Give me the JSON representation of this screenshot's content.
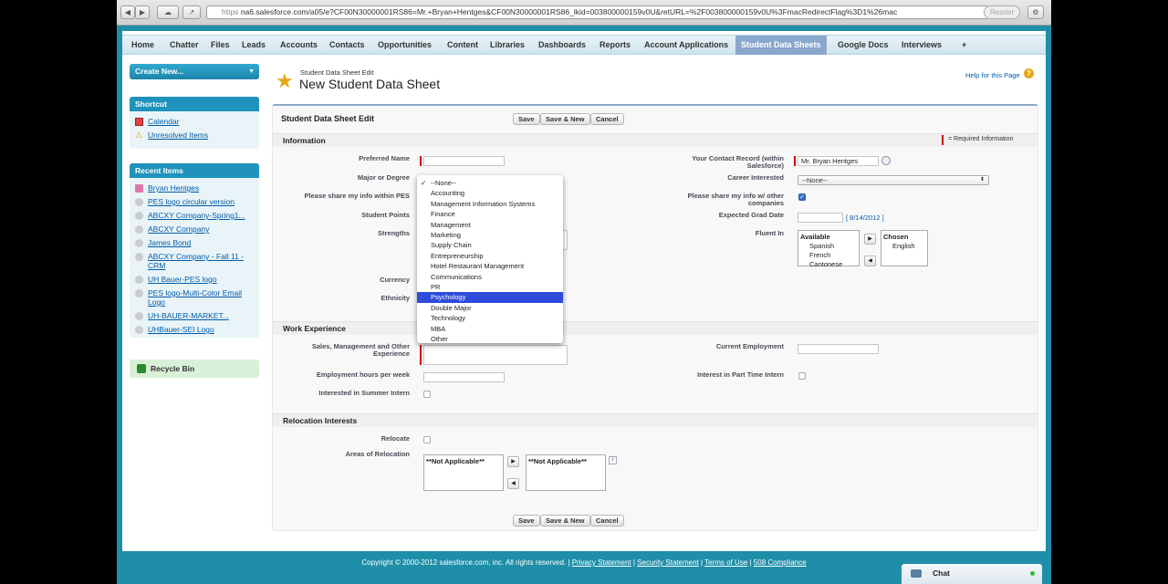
{
  "browser": {
    "url_scheme": "https",
    "url": "na6.salesforce.com/a05/e?CF00N30000001RS86=Mr.+Bryan+Hentges&CF00N30000001RS86_lkid=003800000159v0U&retURL=%2F003800000159v0U%3FmacRedirectFlag%3D1%26mac",
    "reader_label": "Reader"
  },
  "tabs": [
    "Home",
    "Chatter",
    "Files",
    "Leads",
    "Accounts",
    "Contacts",
    "Opportunities",
    "Content",
    "Libraries",
    "Dashboards",
    "Reports",
    "Account Applications",
    "Student Data Sheets",
    "Google Docs",
    "Interviews",
    "+"
  ],
  "sidebar": {
    "create_new": "Create New...",
    "shortcut_title": "Shortcut",
    "shortcuts": [
      "Calendar",
      "Unresolved Items"
    ],
    "recent_title": "Recent Items",
    "recent": [
      "Bryan Hentges",
      "PES logo circular version",
      "ABCXY Company-Spring1...",
      "ABCXY Company",
      "James Bond",
      "ABCXY Company - Fall 11 - CRM",
      "UH Bauer-PES logo",
      "PES logo-Multi-Color Email Logo",
      "UH-BAUER-MARKET...",
      "UHBauer-SEI Logo"
    ],
    "recycle_bin": "Recycle Bin"
  },
  "page": {
    "subtitle": "Student Data Sheet Edit",
    "title": "New Student Data Sheet",
    "help": "Help for this Page"
  },
  "form": {
    "block_title": "Student Data Sheet Edit",
    "save": "Save",
    "save_new": "Save & New",
    "cancel": "Cancel",
    "required_info": "= Required Information",
    "sections": {
      "info": "Information",
      "work": "Work Experience",
      "relocation": "Relocation Interests"
    },
    "labels": {
      "preferred_name": "Preferred Name",
      "major": "Major or Degree",
      "share_pes": "Please share my info within PES",
      "student_points": "Student Points",
      "strengths": "Strengths",
      "currency": "Currency",
      "ethnicity": "Ethnicity",
      "contact_record": "Your Contact Record (within Salesforce)",
      "career": "Career Interested",
      "share_other": "Please share my info w/ other companies",
      "grad_date": "Expected Grad Date",
      "fluent": "Fluent In",
      "sales_exp": "Sales, Management and Other Experience",
      "current_employment": "Current Employment",
      "emp_hours": "Employment hours per week",
      "part_time": "Interest in Part Time Intern",
      "summer": "Interested in Summer Intern",
      "relocate": "Relocate",
      "areas": "Areas of Relocation"
    },
    "contact_value": "Mr. Bryan Hentges",
    "career_value": "--None--",
    "grad_date_link": "[ 8/14/2012 ]",
    "fluent": {
      "available_label": "Available",
      "available": [
        "Spanish",
        "French",
        "Cantonese"
      ],
      "chosen_label": "Chosen",
      "chosen": [
        "English"
      ]
    },
    "relocation_available": "**Not Applicable**",
    "relocation_chosen": "**Not Applicable**"
  },
  "major_dropdown": {
    "checked": "--None--",
    "highlighted": "Psychology",
    "options": [
      "--None--",
      "Accounting",
      "Management Information Systems",
      "Finance",
      "Management",
      "Marketing",
      "Supply Chain",
      "Entrepreneurship",
      "Hotel Restaurant Management",
      "Communications",
      "PR",
      "Psychology",
      "Double Major",
      "Technology",
      "MBA",
      "Other"
    ]
  },
  "footer": {
    "copyright": "Copyright © 2000-2012 salesforce.com, inc. All rights reserved.",
    "links": [
      "Privacy Statement",
      "Security Statement",
      "Terms of Use",
      "508 Compliance"
    ]
  },
  "chat": {
    "label": "Chat"
  },
  "colors": {
    "accent": "#1f93bb",
    "active_tab": "#8aa7cc",
    "highlight": "#2e4bdc",
    "required": "#cc0000"
  }
}
